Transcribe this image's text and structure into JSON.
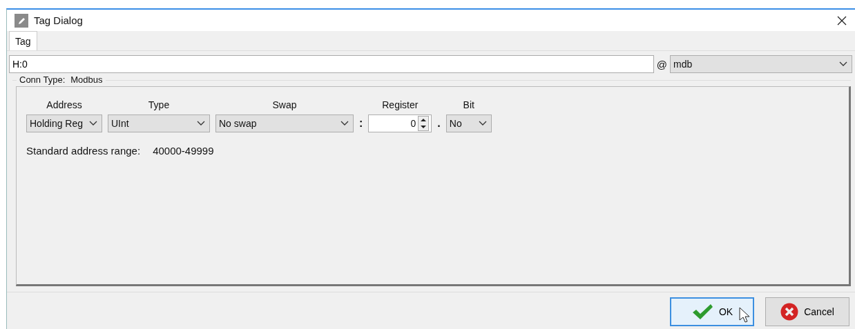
{
  "window": {
    "title": "Tag Dialog"
  },
  "tabs": [
    {
      "label": "Tag",
      "selected": true
    }
  ],
  "tag_field": {
    "value": "H:0"
  },
  "at_sign": "@",
  "connection": {
    "value": "mdb"
  },
  "conn_type": {
    "label": "Conn Type:",
    "value": "Modbus"
  },
  "address_fields": [
    {
      "kind": "combo",
      "header": "Address",
      "value": "Holding Reg"
    },
    {
      "kind": "combo",
      "header": "Type",
      "value": "UInt"
    },
    {
      "kind": "combo",
      "header": "Swap",
      "value": "No swap"
    },
    {
      "kind": "separator",
      "text": ":"
    },
    {
      "kind": "spin",
      "header": "Register",
      "value": "0"
    },
    {
      "kind": "separator",
      "text": "."
    },
    {
      "kind": "combo",
      "header": "Bit",
      "value": "No"
    }
  ],
  "range": {
    "label": "Standard address range:",
    "value": "40000-49999"
  },
  "buttons": [
    {
      "label": "OK",
      "kind": "ok",
      "focused": true
    },
    {
      "label": "Cancel",
      "kind": "cancel",
      "focused": false
    }
  ]
}
